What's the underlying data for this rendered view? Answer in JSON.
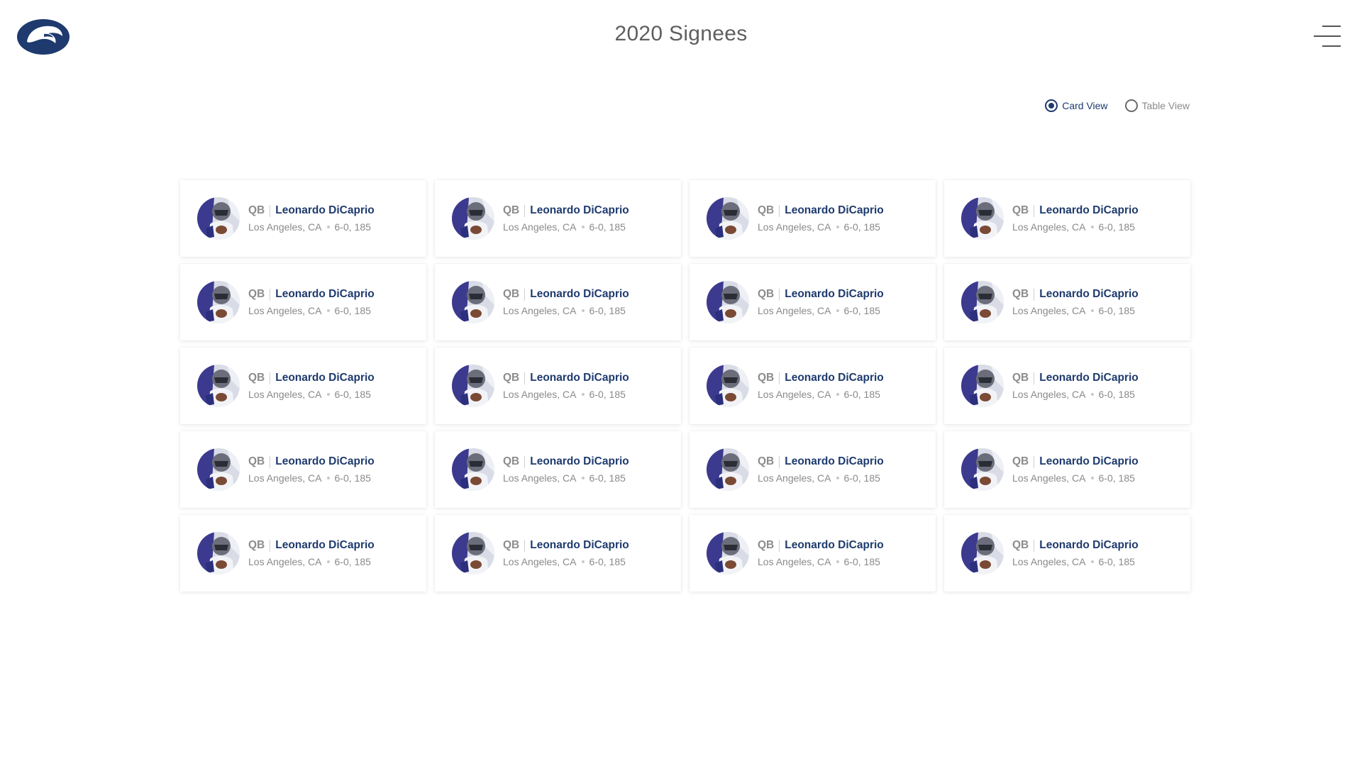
{
  "header": {
    "title": "2020 Signees",
    "logo_icon": "nittany-lion-logo-icon",
    "menu_icon": "hamburger-menu-icon"
  },
  "view_toggle": {
    "options": [
      {
        "label": "Card View",
        "selected": true
      },
      {
        "label": "Table View",
        "selected": false
      }
    ]
  },
  "colors": {
    "accent": "#1e3a6e",
    "text_muted": "#8a8a8a"
  },
  "players": [
    {
      "position": "QB",
      "name": "Leonardo DiCaprio",
      "hometown": "Los Angeles, CA",
      "size": "6-0, 185"
    },
    {
      "position": "QB",
      "name": "Leonardo DiCaprio",
      "hometown": "Los Angeles, CA",
      "size": "6-0, 185"
    },
    {
      "position": "QB",
      "name": "Leonardo DiCaprio",
      "hometown": "Los Angeles, CA",
      "size": "6-0, 185"
    },
    {
      "position": "QB",
      "name": "Leonardo DiCaprio",
      "hometown": "Los Angeles, CA",
      "size": "6-0, 185"
    },
    {
      "position": "QB",
      "name": "Leonardo DiCaprio",
      "hometown": "Los Angeles, CA",
      "size": "6-0, 185"
    },
    {
      "position": "QB",
      "name": "Leonardo DiCaprio",
      "hometown": "Los Angeles, CA",
      "size": "6-0, 185"
    },
    {
      "position": "QB",
      "name": "Leonardo DiCaprio",
      "hometown": "Los Angeles, CA",
      "size": "6-0, 185"
    },
    {
      "position": "QB",
      "name": "Leonardo DiCaprio",
      "hometown": "Los Angeles, CA",
      "size": "6-0, 185"
    },
    {
      "position": "QB",
      "name": "Leonardo DiCaprio",
      "hometown": "Los Angeles, CA",
      "size": "6-0, 185"
    },
    {
      "position": "QB",
      "name": "Leonardo DiCaprio",
      "hometown": "Los Angeles, CA",
      "size": "6-0, 185"
    },
    {
      "position": "QB",
      "name": "Leonardo DiCaprio",
      "hometown": "Los Angeles, CA",
      "size": "6-0, 185"
    },
    {
      "position": "QB",
      "name": "Leonardo DiCaprio",
      "hometown": "Los Angeles, CA",
      "size": "6-0, 185"
    },
    {
      "position": "QB",
      "name": "Leonardo DiCaprio",
      "hometown": "Los Angeles, CA",
      "size": "6-0, 185"
    },
    {
      "position": "QB",
      "name": "Leonardo DiCaprio",
      "hometown": "Los Angeles, CA",
      "size": "6-0, 185"
    },
    {
      "position": "QB",
      "name": "Leonardo DiCaprio",
      "hometown": "Los Angeles, CA",
      "size": "6-0, 185"
    },
    {
      "position": "QB",
      "name": "Leonardo DiCaprio",
      "hometown": "Los Angeles, CA",
      "size": "6-0, 185"
    },
    {
      "position": "QB",
      "name": "Leonardo DiCaprio",
      "hometown": "Los Angeles, CA",
      "size": "6-0, 185"
    },
    {
      "position": "QB",
      "name": "Leonardo DiCaprio",
      "hometown": "Los Angeles, CA",
      "size": "6-0, 185"
    },
    {
      "position": "QB",
      "name": "Leonardo DiCaprio",
      "hometown": "Los Angeles, CA",
      "size": "6-0, 185"
    },
    {
      "position": "QB",
      "name": "Leonardo DiCaprio",
      "hometown": "Los Angeles, CA",
      "size": "6-0, 185"
    }
  ]
}
